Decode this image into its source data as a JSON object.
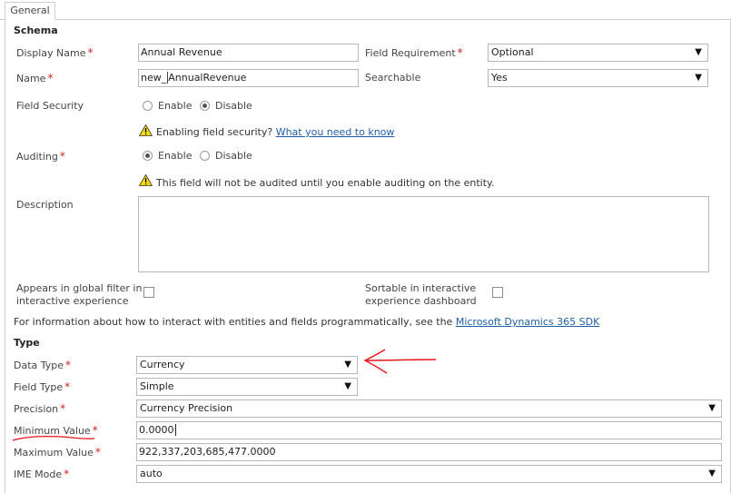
{
  "tabs": {
    "general": "General"
  },
  "schema": {
    "heading": "Schema",
    "display_name_label": "Display Name",
    "display_name_value": "Annual Revenue",
    "field_requirement_label": "Field Requirement",
    "field_requirement_value": "Optional",
    "name_label": "Name",
    "name_prefix": "new_",
    "name_value": "AnnualRevenue",
    "searchable_label": "Searchable",
    "searchable_value": "Yes",
    "field_security_label": "Field Security",
    "enable_label": "Enable",
    "disable_label": "Disable",
    "field_security_selected": "Disable",
    "field_security_warning": "Enabling field security?",
    "field_security_link": "What you need to know",
    "auditing_label": "Auditing",
    "auditing_selected": "Enable",
    "auditing_warning": "This field will not be audited until you enable auditing on the entity.",
    "description_label": "Description",
    "global_filter_label_1": "Appears in global filter in",
    "global_filter_label_2": "interactive experience",
    "sortable_label_1": "Sortable in interactive",
    "sortable_label_2": "experience dashboard",
    "sdk_text": "For information about how to interact with entities and fields programmatically, see the",
    "sdk_link": "Microsoft Dynamics 365 SDK"
  },
  "type": {
    "heading": "Type",
    "data_type_label": "Data Type",
    "data_type_value": "Currency",
    "field_type_label": "Field Type",
    "field_type_value": "Simple",
    "precision_label": "Precision",
    "precision_value": "Currency Precision",
    "min_value_label": "Minimum Value",
    "min_value_value": "0.0000",
    "max_value_label": "Maximum Value",
    "max_value_value": "922,337,203,685,477.0000",
    "ime_mode_label": "IME Mode",
    "ime_mode_value": "auto"
  },
  "icons": {
    "dropdown": "triangle-down-icon",
    "warning": "warning-icon"
  },
  "colors": {
    "required": "#d0232a",
    "link": "#1f5fa8",
    "annotation": "#e8141c"
  }
}
